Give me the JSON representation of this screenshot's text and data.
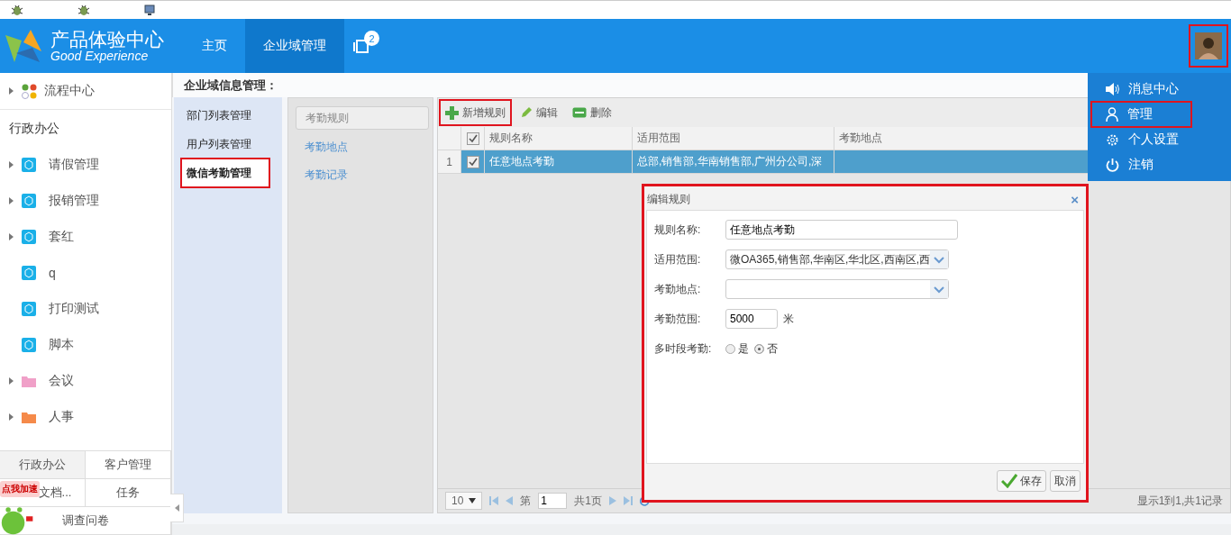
{
  "top_strip": {
    "icons": [
      {
        "kind": "bug"
      },
      {
        "kind": "bug"
      },
      {
        "kind": "monitor"
      }
    ]
  },
  "header": {
    "brand": {
      "title": "产品体验中心",
      "subtitle": "Good Experience"
    },
    "nav": [
      {
        "label": "主页",
        "selected": false
      },
      {
        "label": "企业域管理",
        "selected": true
      }
    ],
    "notification": {
      "badge": "2"
    },
    "avatar": {
      "highlighted": true
    }
  },
  "sidebar": {
    "items": [
      {
        "label": "流程中心",
        "kind": "apps",
        "expandable": true
      },
      {
        "label": "行政办公",
        "kind": "section"
      },
      {
        "label": "请假管理",
        "kind": "cube",
        "color": "#1ab0e8",
        "expandable": true
      },
      {
        "label": "报销管理",
        "kind": "cube",
        "color": "#1ab0e8",
        "expandable": true
      },
      {
        "label": "套红",
        "kind": "cube",
        "color": "#1ab0e8",
        "expandable": true
      },
      {
        "label": "q",
        "kind": "cube",
        "color": "#1ab0e8",
        "expandable": false
      },
      {
        "label": "打印测试",
        "kind": "cube",
        "color": "#1ab0e8",
        "expandable": false
      },
      {
        "label": "脚本",
        "kind": "cube",
        "color": "#1ab0e8",
        "expandable": false
      },
      {
        "label": "会议",
        "kind": "folder",
        "color": "#f0a0c8",
        "expandable": true
      },
      {
        "label": "人事",
        "kind": "folder",
        "color": "#f58a4a",
        "expandable": true
      }
    ],
    "bottom_tabs": [
      {
        "label": "行政办公",
        "selected": true
      },
      {
        "label": "客户管理",
        "selected": false
      },
      {
        "label": "文档...",
        "selected": false
      },
      {
        "label": "任务",
        "selected": false
      },
      {
        "label": "调查问卷",
        "selected": false
      }
    ],
    "speed_badge": "点我加速"
  },
  "page_title": "企业域信息管理：",
  "subnav": [
    {
      "label": "部门列表管理",
      "selected": false,
      "highlighted": false
    },
    {
      "label": "用户列表管理",
      "selected": false,
      "highlighted": false
    },
    {
      "label": "微信考勤管理",
      "selected": true,
      "highlighted": true
    }
  ],
  "tabs": [
    {
      "label": "考勤规则",
      "selected": true
    },
    {
      "label": "考勤地点",
      "selected": false
    },
    {
      "label": "考勤记录",
      "selected": false
    }
  ],
  "toolbar": [
    {
      "label": "新增规则",
      "kind": "add",
      "highlighted": true
    },
    {
      "label": "编辑",
      "kind": "edit",
      "highlighted": false
    },
    {
      "label": "删除",
      "kind": "delete",
      "highlighted": false
    }
  ],
  "table": {
    "header_checked": true,
    "columns": [
      "规则名称",
      "适用范围",
      "考勤地点"
    ],
    "rows": [
      {
        "number": "1",
        "checked": true,
        "selected": true,
        "cells": [
          "任意地点考勤",
          "总部,销售部,华南销售部,广州分公司,深",
          ""
        ]
      }
    ]
  },
  "pager": {
    "page_size": "10",
    "page_label": "第",
    "page": "1",
    "total_pages": "共1页",
    "summary": "显示1到1,共1记录"
  },
  "dialog": {
    "title": "编辑规则",
    "close": "×",
    "highlighted": true,
    "fields": [
      {
        "label": "规则名称:",
        "kind": "text",
        "value": "任意地点考勤"
      },
      {
        "label": "适用范围:",
        "kind": "select",
        "value": "微OA365,销售部,华南区,华北区,西南区,西"
      },
      {
        "label": "考勤地点:",
        "kind": "select"
      },
      {
        "label": "考勤范围:",
        "kind": "number",
        "value": "5000",
        "unit": "米"
      },
      {
        "label": "多时段考勤:",
        "kind": "radio",
        "options": [
          {
            "label": "是",
            "selected": false
          },
          {
            "label": "否",
            "selected": true
          }
        ]
      }
    ],
    "buttons": [
      {
        "label": "保存",
        "kind": "save"
      },
      {
        "label": "取消",
        "kind": "cancel"
      }
    ]
  },
  "user_menu": [
    {
      "label": "消息中心",
      "kind": "speaker",
      "highlighted": false
    },
    {
      "label": "管理",
      "kind": "user",
      "highlighted": true
    },
    {
      "label": "个人设置",
      "kind": "gear",
      "highlighted": false
    },
    {
      "label": "注销",
      "kind": "power",
      "highlighted": false
    }
  ]
}
